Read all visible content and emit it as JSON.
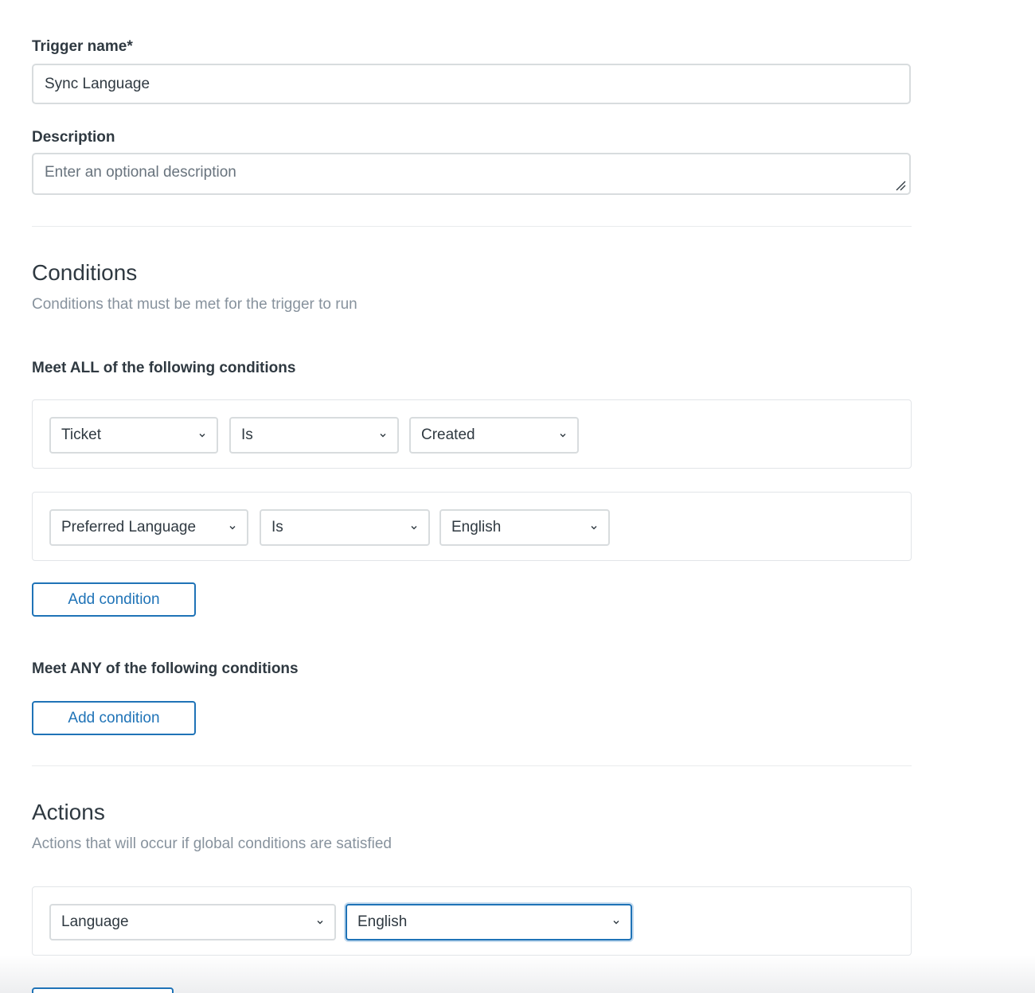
{
  "form": {
    "trigger_name_label": "Trigger name*",
    "trigger_name_value": "Sync Language",
    "description_label": "Description",
    "description_placeholder": "Enter an optional description"
  },
  "conditions": {
    "title": "Conditions",
    "subtitle": "Conditions that must be met for the trigger to run",
    "all_label": "Meet ALL of the following conditions",
    "all_rows": [
      {
        "field": "Ticket",
        "operator": "Is",
        "value": "Created"
      },
      {
        "field": "Preferred Language",
        "operator": "Is",
        "value": "English"
      }
    ],
    "all_add_label": "Add condition",
    "any_label": "Meet ANY of the following conditions",
    "any_add_label": "Add condition"
  },
  "actions": {
    "title": "Actions",
    "subtitle": "Actions that will occur if global conditions are satisfied",
    "rows": [
      {
        "field": "Language",
        "value": "English"
      }
    ]
  },
  "colors": {
    "accent": "#1f73b7",
    "border": "#d8dcde",
    "text": "#2f3941",
    "muted": "#87929d"
  },
  "icons": {
    "select_arrow": "chevron-down-icon",
    "textarea_grip": "resize-grip-icon"
  }
}
